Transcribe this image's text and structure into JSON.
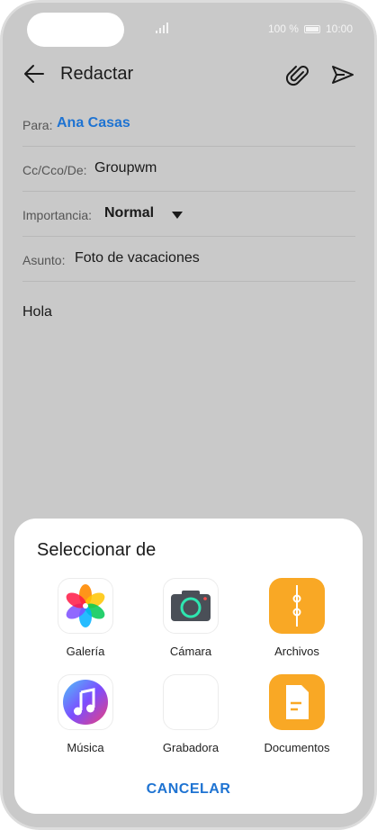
{
  "status": {
    "battery_text": "100 %",
    "time": "10:00"
  },
  "header": {
    "title": "Redactar"
  },
  "fields": {
    "to_label": "Para:",
    "to_value": "Ana Casas",
    "cc_label": "Cc/Cco/De:",
    "cc_value": "Groupwm",
    "importance_label": "Importancia:",
    "importance_value": "Normal",
    "subject_label": "Asunto:",
    "subject_value": "Foto de vacaciones"
  },
  "body": {
    "text": "Hola"
  },
  "sheet": {
    "title": "Seleccionar de",
    "apps": [
      {
        "label": "Galería",
        "icon": "gallery-icon"
      },
      {
        "label": "Cámara",
        "icon": "camera-icon"
      },
      {
        "label": "Archivos",
        "icon": "files-icon"
      },
      {
        "label": "Música",
        "icon": "music-icon"
      },
      {
        "label": "Grabadora",
        "icon": "recorder-icon"
      },
      {
        "label": "Documentos",
        "icon": "documents-icon"
      }
    ],
    "cancel_label": "CANCELAR"
  },
  "colors": {
    "accent": "#1e73d2",
    "orange": "#f9a825",
    "overlay": "#c9c9c9"
  }
}
